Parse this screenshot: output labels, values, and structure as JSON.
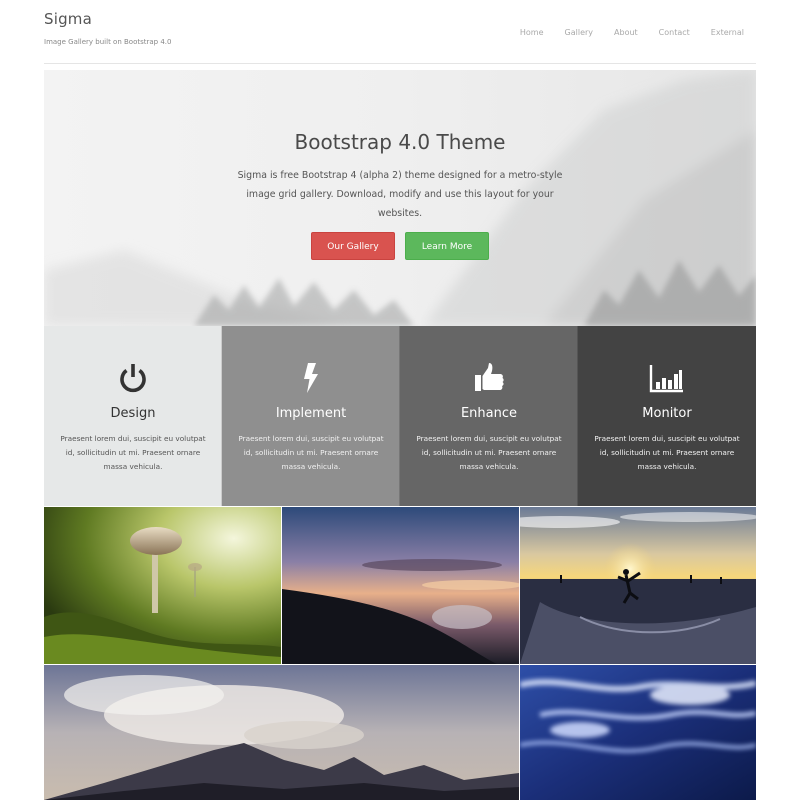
{
  "header": {
    "brand": "Sigma",
    "tagline": "Image Gallery built on Bootstrap 4.0",
    "nav": [
      "Home",
      "Gallery",
      "About",
      "Contact",
      "External"
    ]
  },
  "hero": {
    "title": "Bootstrap 4.0 Theme",
    "text": "Sigma is free Bootstrap 4 (alpha 2) theme designed for a metro-style image grid gallery. Download, modify and use this layout for your websites.",
    "primary_button": "Our Gallery",
    "secondary_button": "Learn More"
  },
  "features": [
    {
      "title": "Design",
      "icon": "power-icon",
      "text": "Praesent lorem dui, suscipit eu volutpat id, sollicitudin ut mi. Praesent ornare massa vehicula."
    },
    {
      "title": "Implement",
      "icon": "bolt-icon",
      "text": "Praesent lorem dui, suscipit eu volutpat id, sollicitudin ut mi. Praesent ornare massa vehicula."
    },
    {
      "title": "Enhance",
      "icon": "thumbs-up-icon",
      "text": "Praesent lorem dui, suscipit eu volutpat id, sollicitudin ut mi. Praesent ornare massa vehicula."
    },
    {
      "title": "Monitor",
      "icon": "bar-chart-icon",
      "text": "Praesent lorem dui, suscipit eu volutpat id, sollicitudin ut mi. Praesent ornare massa vehicula."
    }
  ],
  "colors": {
    "primary_button": "#d9534f",
    "secondary_button": "#5cb85c",
    "feature_backgrounds": [
      "#e6e8e8",
      "#8f8f8f",
      "#666666",
      "#434343"
    ]
  },
  "gallery": [
    {
      "name": "gallery-image-mushroom"
    },
    {
      "name": "gallery-image-sunset-clouds"
    },
    {
      "name": "gallery-image-skatepark"
    },
    {
      "name": "gallery-image-mountains"
    },
    {
      "name": "gallery-image-ocean-waves"
    }
  ]
}
